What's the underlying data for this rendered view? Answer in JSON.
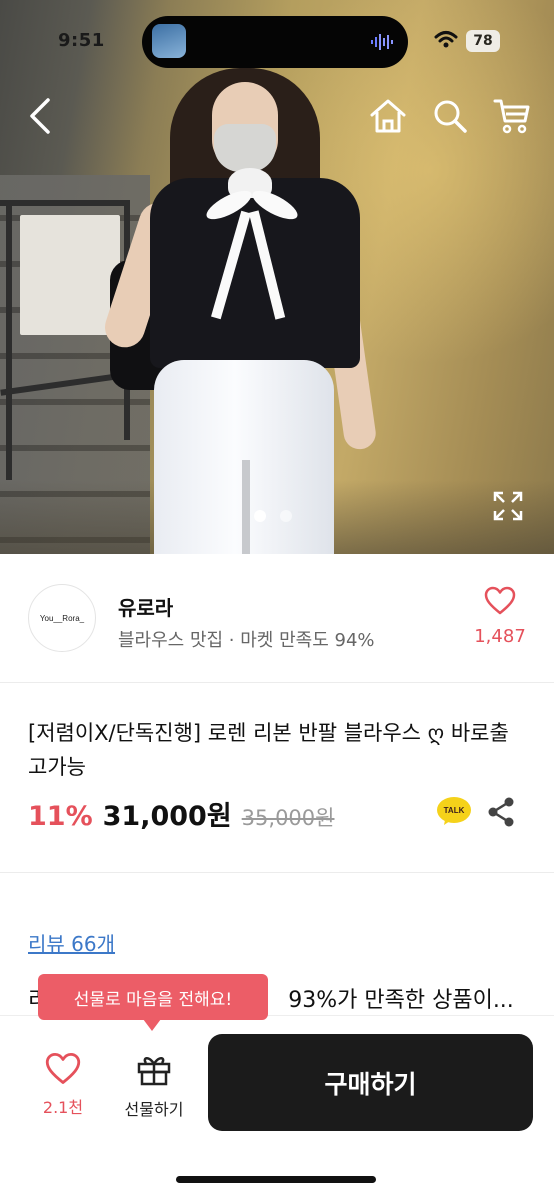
{
  "status_bar": {
    "time": "9:51",
    "battery": "78"
  },
  "top_nav": {
    "back_icon": "chevron-left-icon",
    "home_icon": "home-icon",
    "search_icon": "search-icon",
    "cart_icon": "cart-icon",
    "expand_icon": "expand-icon"
  },
  "gallery": {
    "page_count": 2,
    "active_index": 0
  },
  "seller": {
    "avatar_text": "You__Rora_",
    "name": "유로라",
    "description": "블라우스 맛집 · 마켓 만족도 94%",
    "like_count": "1,487"
  },
  "product": {
    "title": "[저렴이X/단독진행] 로렌 리본 반팔 블라우스 ღ 바로출고가능",
    "discount": "11%",
    "price": "31,000원",
    "original_price": "35,000원",
    "talk_label": "TALK"
  },
  "reviews": {
    "link": "리뷰 66개",
    "summary_prefix": "리",
    "summary": "93%가 만족한 상품이..."
  },
  "tooltip": {
    "text": "선물로 마음을 전해요!"
  },
  "bottom_bar": {
    "wish_count": "2.1천",
    "gift_label": "선물하기",
    "buy_label": "구매하기"
  },
  "colors": {
    "accent": "#e5515b",
    "tooltip": "#ec5d67",
    "buy_button": "#1b1b1b",
    "link": "#3c78c8"
  }
}
